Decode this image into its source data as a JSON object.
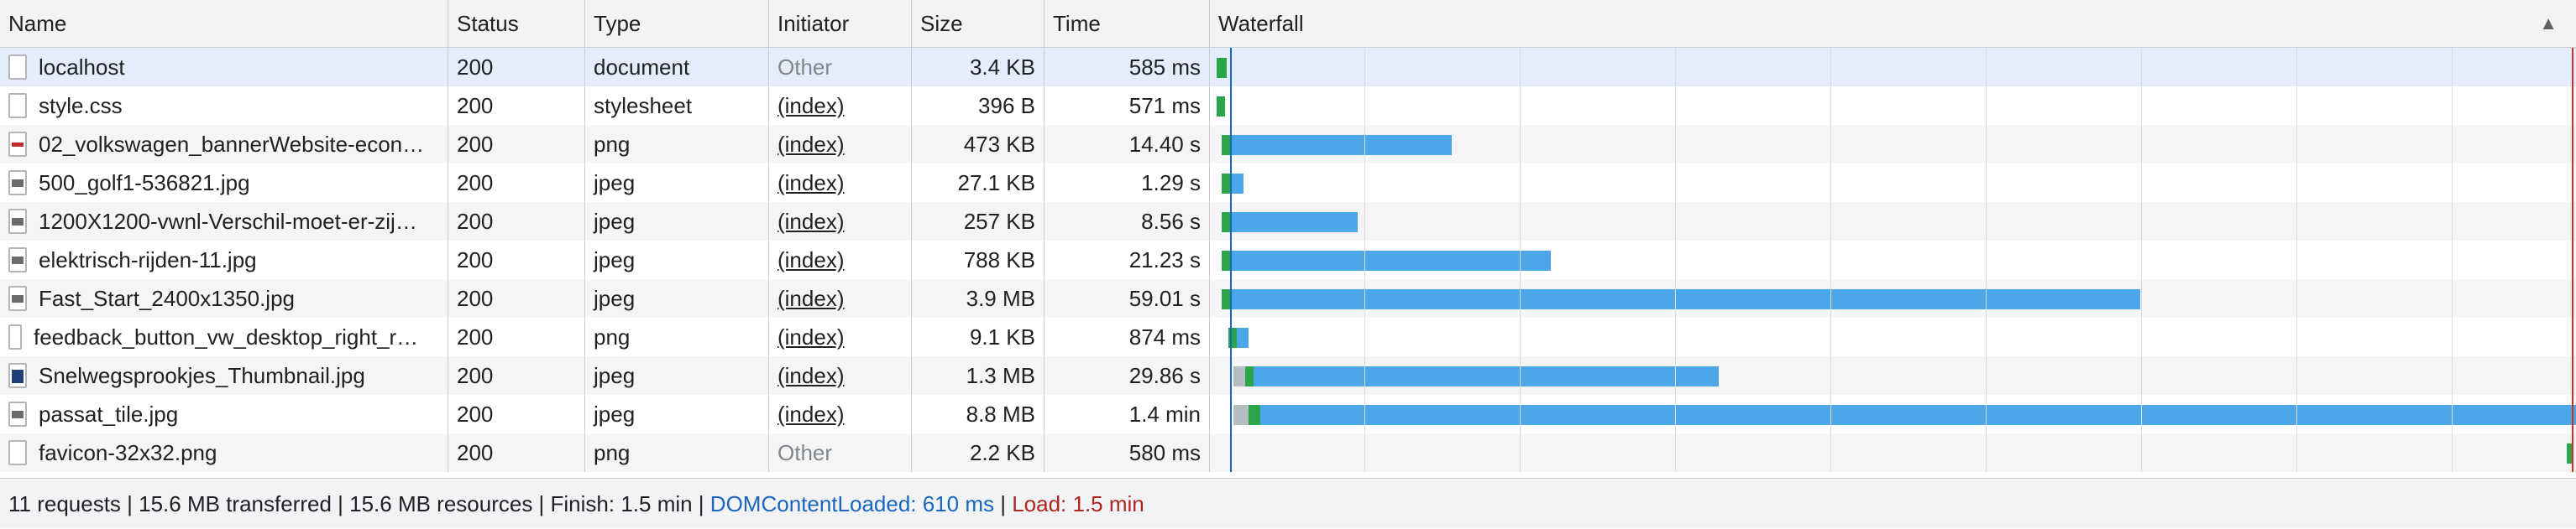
{
  "columns": {
    "name": "Name",
    "status": "Status",
    "type": "Type",
    "initiator": "Initiator",
    "size": "Size",
    "time": "Time",
    "waterfall": "Waterfall",
    "sort_glyph": "▲"
  },
  "rows": [
    {
      "name": "localhost",
      "status": "200",
      "type": "document",
      "initiator": "Other",
      "size": "3.4 KB",
      "time": "585 ms",
      "icon": "document-icon"
    },
    {
      "name": "style.css",
      "status": "200",
      "type": "stylesheet",
      "initiator": "(index)",
      "size": "396 B",
      "time": "571 ms",
      "icon": "document-icon"
    },
    {
      "name": "02_volkswagen_bannerWebsite-econ…",
      "status": "200",
      "type": "png",
      "initiator": "(index)",
      "size": "473 KB",
      "time": "14.40 s",
      "icon": "image-icon"
    },
    {
      "name": "500_golf1-536821.jpg",
      "status": "200",
      "type": "jpeg",
      "initiator": "(index)",
      "size": "27.1 KB",
      "time": "1.29 s",
      "icon": "image-icon"
    },
    {
      "name": "1200X1200-vwnl-Verschil-moet-er-zij…",
      "status": "200",
      "type": "jpeg",
      "initiator": "(index)",
      "size": "257 KB",
      "time": "8.56 s",
      "icon": "image-icon"
    },
    {
      "name": "elektrisch-rijden-11.jpg",
      "status": "200",
      "type": "jpeg",
      "initiator": "(index)",
      "size": "788 KB",
      "time": "21.23 s",
      "icon": "image-icon"
    },
    {
      "name": "Fast_Start_2400x1350.jpg",
      "status": "200",
      "type": "jpeg",
      "initiator": "(index)",
      "size": "3.9 MB",
      "time": "59.01 s",
      "icon": "image-icon"
    },
    {
      "name": "feedback_button_vw_desktop_right_r…",
      "status": "200",
      "type": "png",
      "initiator": "(index)",
      "size": "9.1 KB",
      "time": "874 ms",
      "icon": "image-icon"
    },
    {
      "name": "Snelwegsprookjes_Thumbnail.jpg",
      "status": "200",
      "type": "jpeg",
      "initiator": "(index)",
      "size": "1.3 MB",
      "time": "29.86 s",
      "icon": "image-icon"
    },
    {
      "name": "passat_tile.jpg",
      "status": "200",
      "type": "jpeg",
      "initiator": "(index)",
      "size": "8.8 MB",
      "time": "1.4 min",
      "icon": "image-icon"
    },
    {
      "name": "favicon-32x32.png",
      "status": "200",
      "type": "png",
      "initiator": "Other",
      "size": "2.2 KB",
      "time": "580 ms",
      "icon": "document-icon"
    }
  ],
  "footer": {
    "summary": "11 requests | 15.6 MB transferred | 15.6 MB resources | Finish: 1.5 min | ",
    "dom_content_loaded": "DOMContentLoaded: 610 ms",
    "separator": " | ",
    "load": "Load: 1.5 min"
  },
  "colors": {
    "waiting": "#b6bcc3",
    "ttfb": "#2ba54a",
    "download": "#4aa7ea",
    "dom_line": "#1a65c0",
    "load_line": "#d0312d",
    "selected_row": "#e4edfc"
  }
}
